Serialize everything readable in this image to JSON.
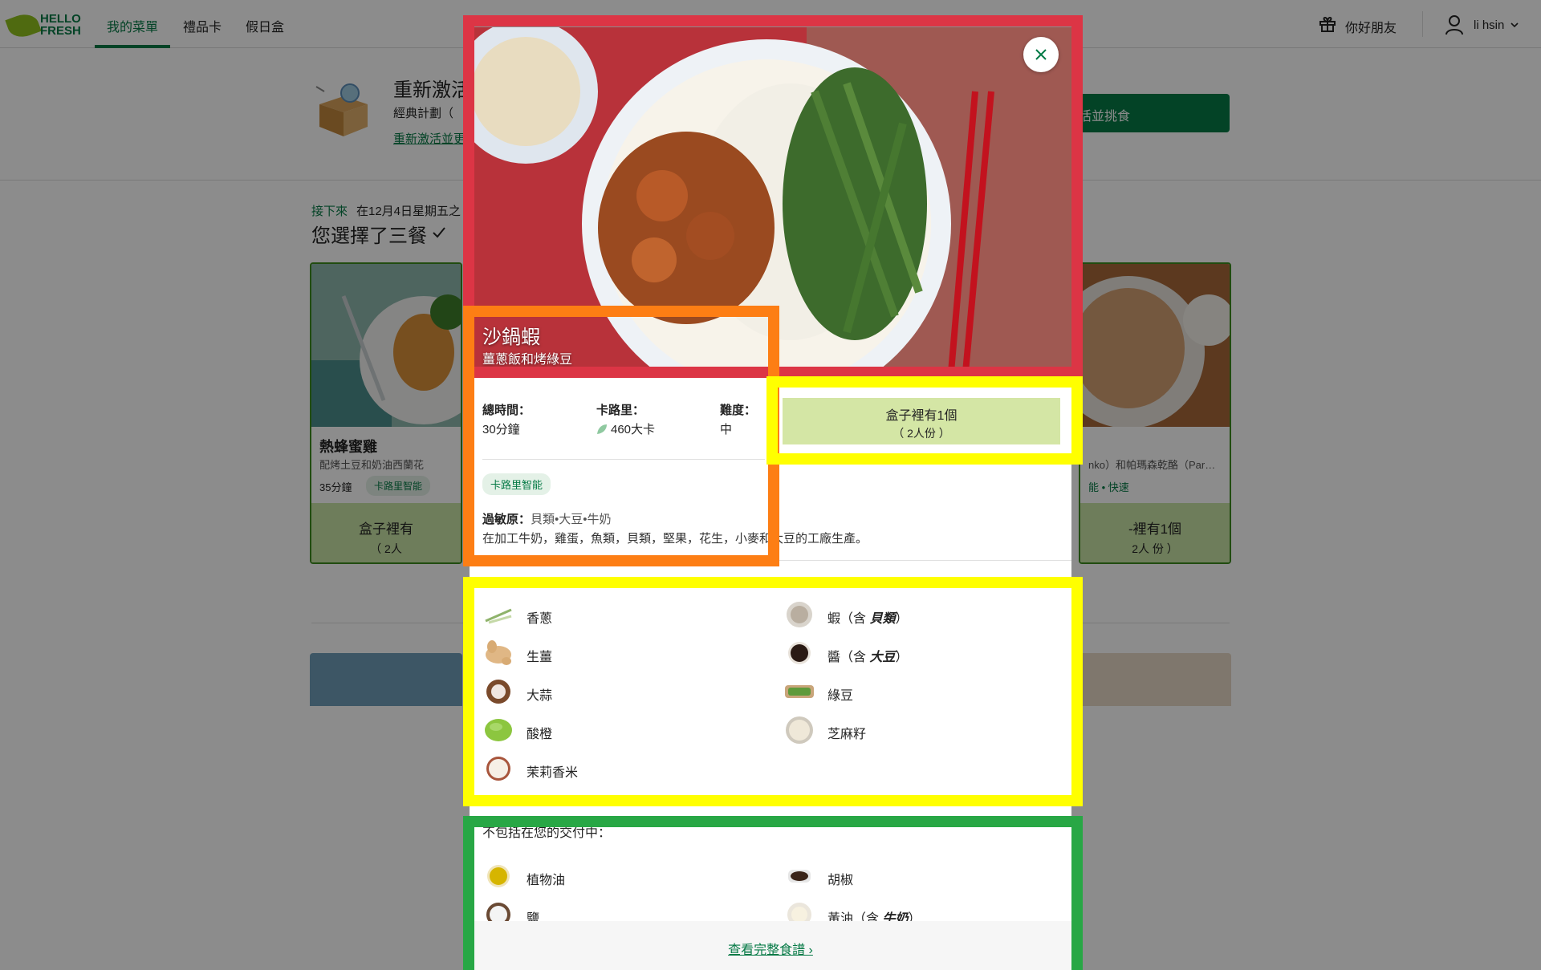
{
  "nav": {
    "logo": "HELLO FRESH",
    "tabs": [
      "我的菜單",
      "禮品卡",
      "假日盒"
    ],
    "friend": "你好朋友",
    "user": "li hsin"
  },
  "promo": {
    "title": "重新激活",
    "plan": "經典計劃（",
    "link": "重新激活並更",
    "button": "活並挑食"
  },
  "schedule": {
    "next_label": "接下來",
    "next_date": "在12月4日星期五之",
    "chosen": "您選擇了三餐"
  },
  "cards": [
    {
      "title": "熱蜂蜜雞",
      "subtitle": "配烤土豆和奶油西蘭花",
      "time": "35分鐘",
      "tag": "卡路里智能",
      "footer_title": "盒子裡有",
      "footer_sub": "（ 2人"
    },
    {
      "subtitle": "nko）和帕瑪森乾酪（Par…",
      "tag": "能",
      "tag2": "• 快速",
      "footer_title": "-裡有1個",
      "footer_sub": "2人 份 ）"
    }
  ],
  "recipe": {
    "title": "沙鍋蝦",
    "subtitle": "薑蔥飯和烤綠豆",
    "stats": [
      {
        "label": "總時間：",
        "value": "30分鐘"
      },
      {
        "label": "卡路里：",
        "value": "460大卡"
      },
      {
        "label": "難度：",
        "value": "中"
      }
    ],
    "inbox_title": "盒子裡有1個",
    "inbox_sub": "（ 2人份 ）",
    "tag": "卡路里智能",
    "allergen_label": "過敏原：",
    "allergen_value": "貝類•大豆•牛奶",
    "factory_note": "在加工牛奶，雞蛋，魚類，貝類，堅果，花生，小麥和大豆的工廠生產。",
    "ingredients_left": [
      "香蔥",
      "生薑",
      "大蒜",
      "酸橙",
      "茉莉香米"
    ],
    "ingredients_right": [
      {
        "name": "蝦（含 ",
        "allergen": "貝類",
        "close": "）"
      },
      {
        "name": "醬（含 ",
        "allergen": "大豆",
        "close": "）"
      },
      {
        "name": "綠豆",
        "allergen": "",
        "close": ""
      },
      {
        "name": "芝麻籽",
        "allergen": "",
        "close": ""
      }
    ],
    "not_included_label": "不包括在您的交付中：",
    "not_included_left": [
      "植物油",
      "鹽"
    ],
    "not_included_right": [
      {
        "name": "胡椒",
        "allergen": "",
        "close": ""
      },
      {
        "name": "黃油（含 ",
        "allergen": "牛奶",
        "close": "）"
      }
    ],
    "full_recipe_link": "查看完整食譜 ›"
  },
  "colors": {
    "brand_green": "#067a46",
    "leaf_green": "#91c11e",
    "inbox_bg": "#d4e6a5",
    "frame_red": "#dc3545",
    "frame_orange": "#fd7e14",
    "frame_yellow": "#ffff00",
    "frame_green": "#28a745"
  }
}
